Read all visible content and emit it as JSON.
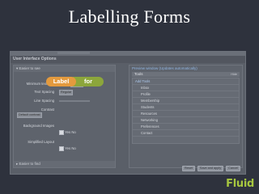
{
  "slide": {
    "title": "Labelling Forms"
  },
  "window": {
    "title": "User Interface Options"
  },
  "left_panel": {
    "header": "Easier to see",
    "footer": "Easier to find",
    "rows": [
      {
        "label": "Minimum text size",
        "value": "pt"
      },
      {
        "label": "Text Spacing",
        "value": "Regular"
      },
      {
        "label": "Line Spacing",
        "value": ""
      },
      {
        "label": "Contrast",
        "value": "Default contrast"
      },
      {
        "label": "Background Images",
        "value": "Yes  No"
      },
      {
        "label": "Simplified Layout",
        "value": "Yes  No"
      }
    ]
  },
  "right_panel": {
    "title": "Preview window (Updates automatically)",
    "tools_header": "Tools",
    "tools_right": "Hide",
    "tools": [
      "Add Tools",
      "Inbox",
      "Profile",
      "Membership",
      "Students",
      "Resources",
      "Networking",
      "Preferences",
      "Contact"
    ]
  },
  "buttons": {
    "reset": "Reset",
    "save": "Save and apply",
    "cancel": "Cancel"
  },
  "tags": {
    "label": "Label",
    "for": "for"
  },
  "logo": {
    "text": "Fluid"
  },
  "colors": {
    "label_tag": "#e39a3e",
    "for_tag": "#8ca63b",
    "logo": "#a6c63f"
  }
}
